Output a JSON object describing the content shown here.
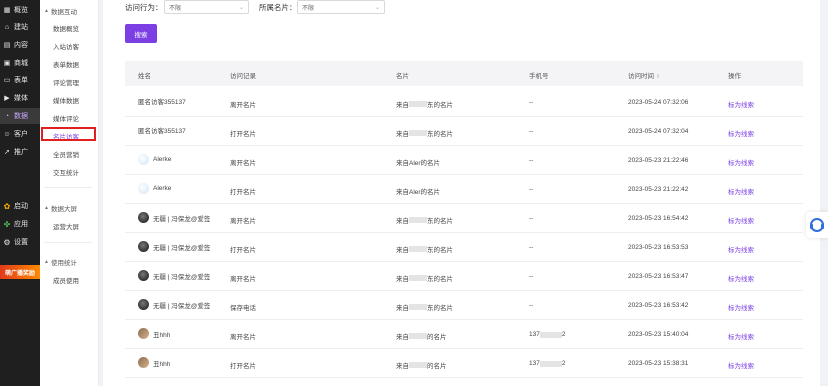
{
  "nav": {
    "items": [
      {
        "label": "概览",
        "icon": "grid-icon"
      },
      {
        "label": "建站",
        "icon": "build-icon"
      },
      {
        "label": "内容",
        "icon": "content-icon"
      },
      {
        "label": "商城",
        "icon": "shop-icon"
      },
      {
        "label": "表单",
        "icon": "form-icon"
      },
      {
        "label": "媒体",
        "icon": "media-icon"
      },
      {
        "label": "数据",
        "icon": "data-icon"
      },
      {
        "label": "客户",
        "icon": "customer-icon"
      },
      {
        "label": "推广",
        "icon": "promote-icon"
      }
    ],
    "bottom": [
      {
        "label": "启动",
        "icon": "launch-icon"
      },
      {
        "label": "应用",
        "icon": "apps-icon"
      },
      {
        "label": "设置",
        "icon": "settings-icon"
      }
    ],
    "promo": "萌广播奖励"
  },
  "submenu": {
    "groups": [
      {
        "title": "数据互动",
        "items": [
          "数据概览",
          "入站访客",
          "表单数据",
          "评论管理",
          "媒体数据",
          "媒体评论",
          "名片访客",
          "全员营销",
          "交互统计"
        ]
      },
      {
        "title": "数据大屏",
        "items": [
          "运营大屏"
        ]
      },
      {
        "title": "使用统计",
        "items": [
          "成员使用"
        ]
      }
    ],
    "active": "名片访客"
  },
  "filters": {
    "action_label": "访问行为：",
    "action_value": "不限",
    "card_label": "所属名片：",
    "card_value": "不限",
    "search_button": "搜索"
  },
  "table": {
    "headers": [
      "姓名",
      "访问记录",
      "名片",
      "手机号",
      "访问时间",
      "操作"
    ],
    "rows": [
      {
        "name": "匿名访客355137",
        "record": "离开名片",
        "card_pre": "来自",
        "card_post": "东的名片",
        "phone_pre": "--",
        "phone_post": "",
        "time": "2023-05-24 07:32:06",
        "action": "标为线索",
        "avatar": ""
      },
      {
        "name": "匿名访客355137",
        "record": "打开名片",
        "card_pre": "来自",
        "card_post": "东的名片",
        "phone_pre": "--",
        "phone_post": "",
        "time": "2023-05-24 07:32:04",
        "action": "标为线索",
        "avatar": ""
      },
      {
        "name": "Alerke",
        "record": "离开名片",
        "card_pre": "来自Aler的名片",
        "card_post": "",
        "phone_pre": "--",
        "phone_post": "",
        "time": "2023-05-23 21:22:46",
        "action": "标为线索",
        "avatar": "light"
      },
      {
        "name": "Alerke",
        "record": "打开名片",
        "card_pre": "来自Aler的名片",
        "card_post": "",
        "phone_pre": "--",
        "phone_post": "",
        "time": "2023-05-23 21:22:42",
        "action": "标为线索",
        "avatar": "light"
      },
      {
        "name": "无疆 | 冯保龙@爱签",
        "record": "离开名片",
        "card_pre": "来自",
        "card_post": "东的名片",
        "phone_pre": "--",
        "phone_post": "",
        "time": "2023-05-23 16:54:42",
        "action": "标为线索",
        "avatar": "dark"
      },
      {
        "name": "无疆 | 冯保龙@爱签",
        "record": "打开名片",
        "card_pre": "来自",
        "card_post": "东的名片",
        "phone_pre": "--",
        "phone_post": "",
        "time": "2023-05-23 16:53:53",
        "action": "标为线索",
        "avatar": "dark"
      },
      {
        "name": "无疆 | 冯保龙@爱签",
        "record": "离开名片",
        "card_pre": "来自",
        "card_post": "东的名片",
        "phone_pre": "--",
        "phone_post": "",
        "time": "2023-05-23 16:53:47",
        "action": "标为线索",
        "avatar": "dark"
      },
      {
        "name": "无疆 | 冯保龙@爱签",
        "record": "保存电话",
        "card_pre": "来自",
        "card_post": "东的名片",
        "phone_pre": "--",
        "phone_post": "",
        "time": "2023-05-23 16:53:42",
        "action": "标为线索",
        "avatar": "dark"
      },
      {
        "name": "丑hhh",
        "record": "离开名片",
        "card_pre": "来自",
        "card_post": "的名片",
        "phone_pre": "137",
        "phone_post": "2",
        "time": "2023-05-23 15:40:04",
        "action": "标为线索",
        "avatar": "photo"
      },
      {
        "name": "丑hhh",
        "record": "打开名片",
        "card_pre": "来自",
        "card_post": "的名片",
        "phone_pre": "137",
        "phone_post": "2",
        "time": "2023-05-23 15:38:31",
        "action": "标为线索",
        "avatar": "photo"
      }
    ]
  },
  "colors": {
    "accent": "#7b3fe4",
    "sidebar": "#1f1f1f",
    "highlight": "#e02020"
  }
}
